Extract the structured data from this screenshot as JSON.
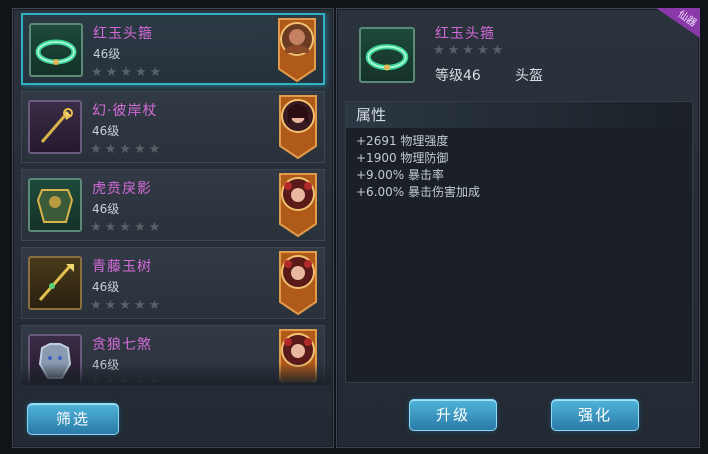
{
  "items": [
    {
      "name": "红玉头箍",
      "level": "46级",
      "stars": "★★★★★",
      "selected": true
    },
    {
      "name": "幻·彼岸杖",
      "level": "46级",
      "stars": "★★★★★",
      "selected": false
    },
    {
      "name": "虎贲戾影",
      "level": "46级",
      "stars": "★★★★★",
      "selected": false
    },
    {
      "name": "青藤玉树",
      "level": "46级",
      "stars": "★★★★★",
      "selected": false
    },
    {
      "name": "贪狼七煞",
      "level": "46级",
      "stars": "★★★★★",
      "selected": false
    }
  ],
  "filter_label": "筛选",
  "detail": {
    "name": "红玉头箍",
    "stars": "★★★★★",
    "level": "等级46",
    "slot": "头盔",
    "corner_tag": "仙器",
    "attr_title": "属性",
    "attributes": [
      "+2691 物理强度",
      "+1900 物理防御",
      "+9.00% 暴击率",
      "+6.00% 暴击伤害加成"
    ]
  },
  "upgrade_label": "升级",
  "enhance_label": "强化",
  "colors": {
    "accent": "#2fb3c4",
    "item_name": "#d46bd8",
    "button": "#3a96c4",
    "badge": "#c46a20"
  }
}
